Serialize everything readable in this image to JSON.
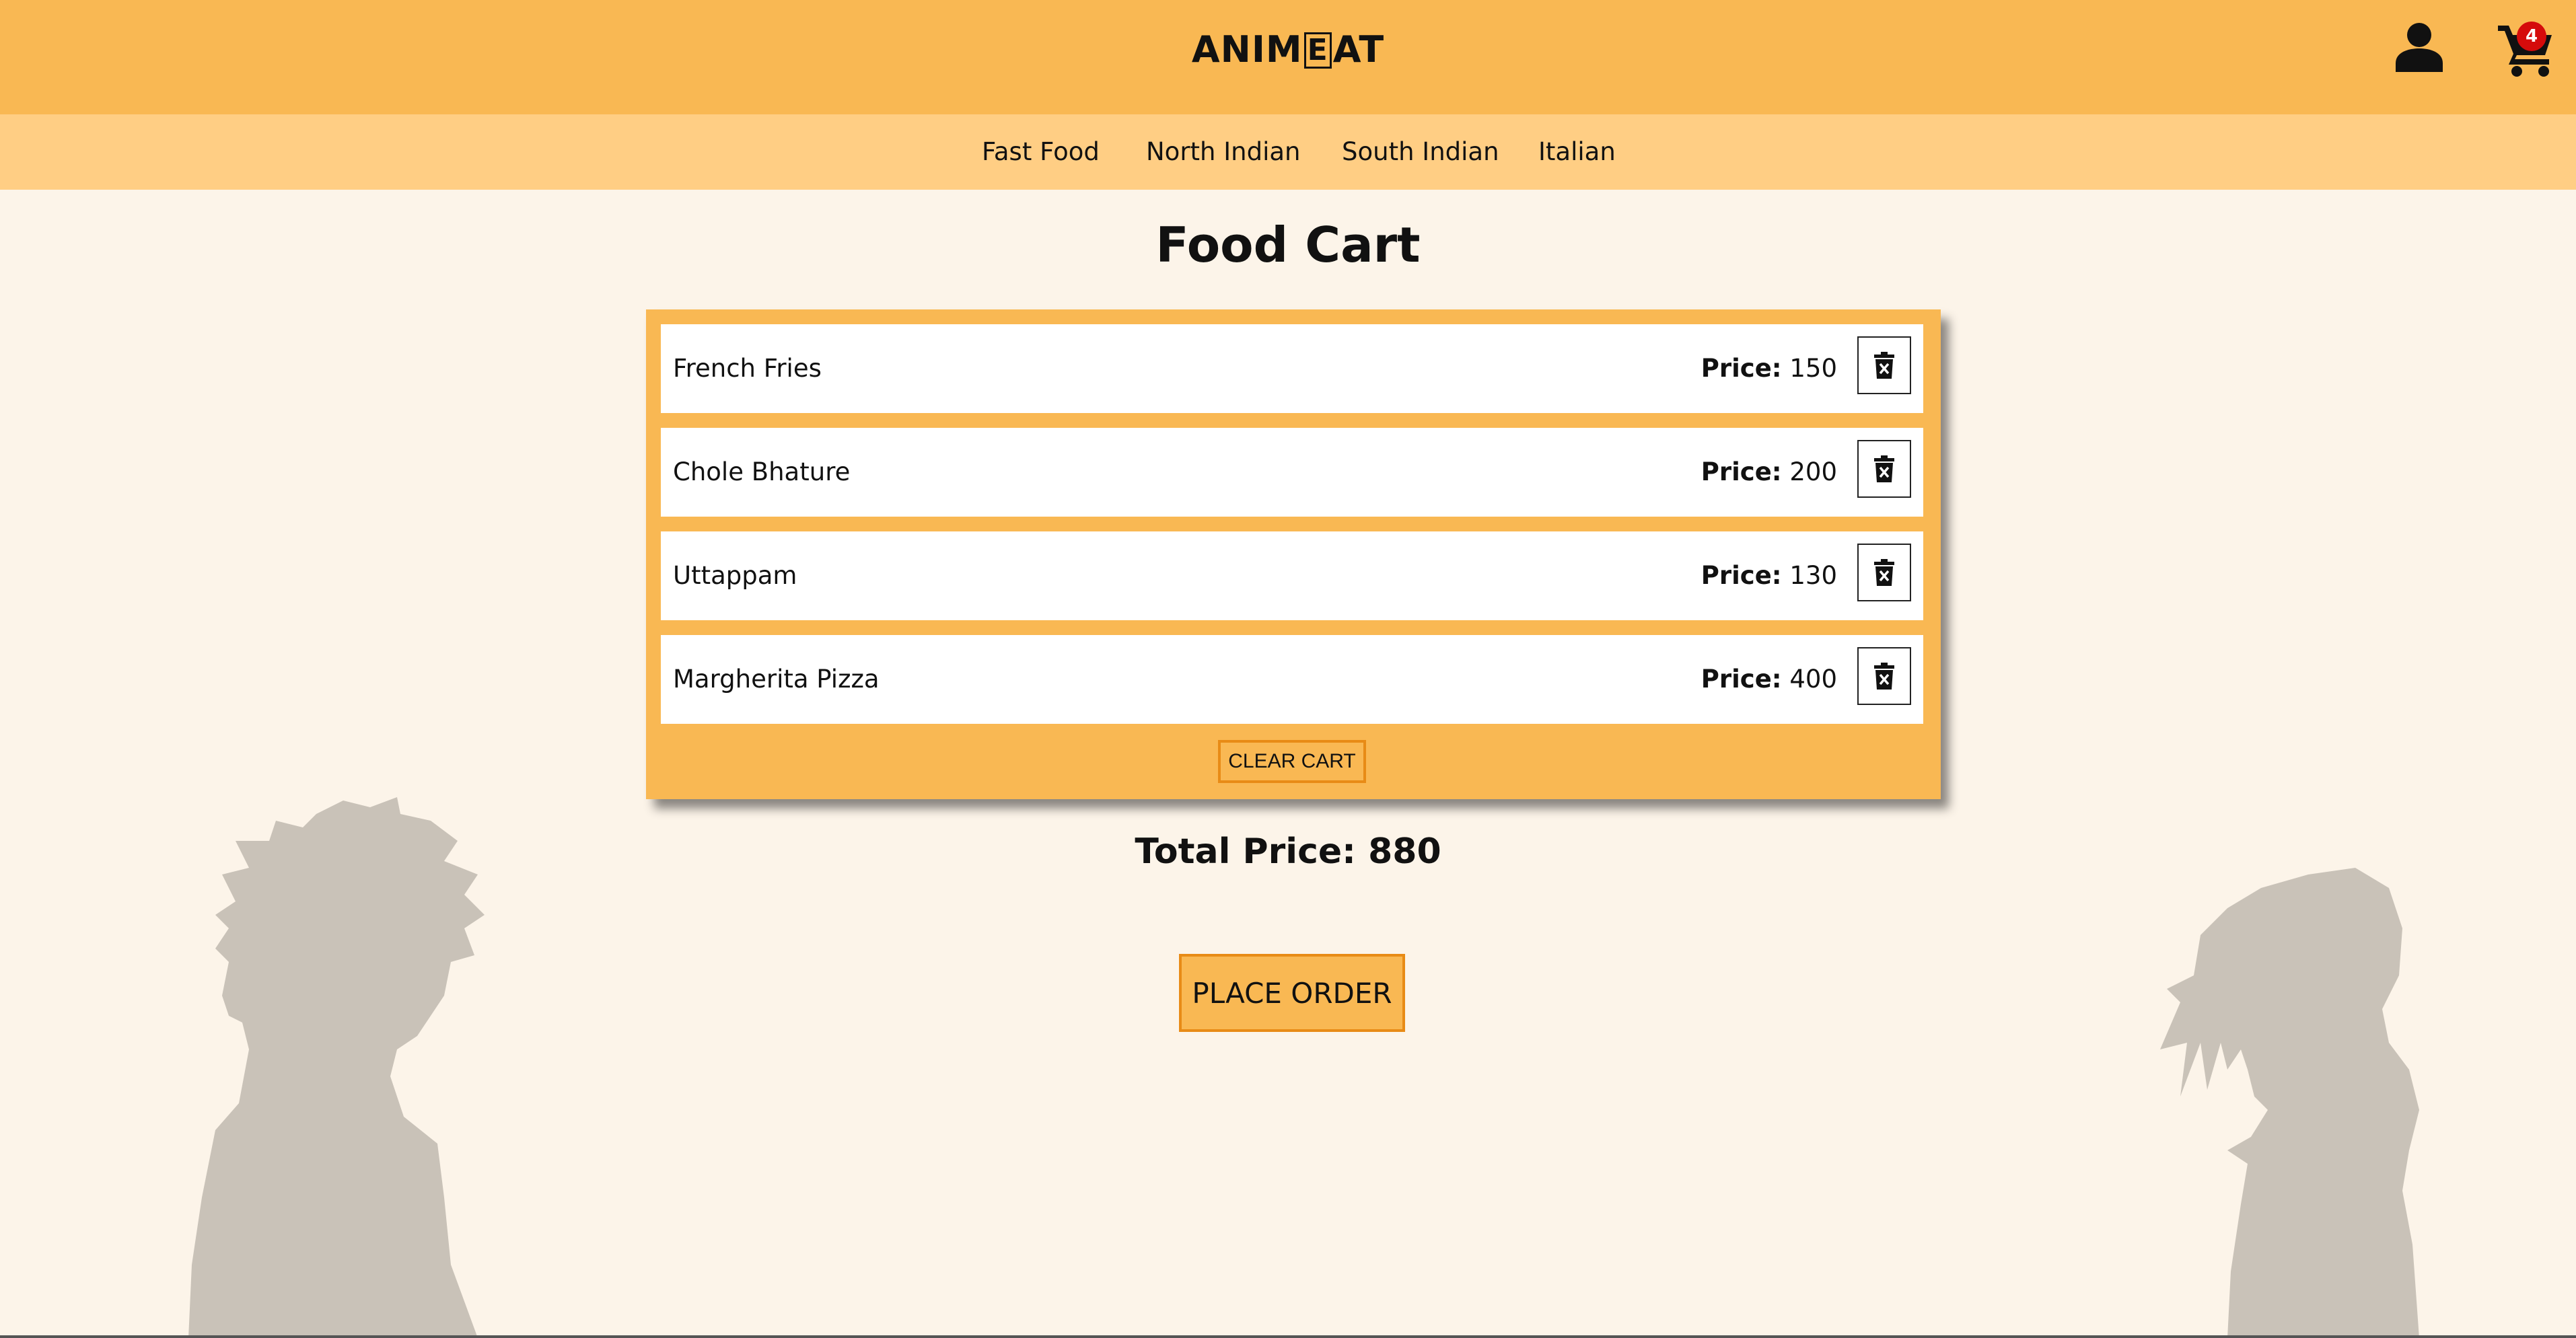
{
  "header": {
    "brand_prefix": "ANIM",
    "brand_boxed": "E",
    "brand_suffix": "AT",
    "cart_count": "4",
    "user_icon": "user-icon",
    "cart_icon": "cart-icon"
  },
  "nav": {
    "items": [
      {
        "label": "Fast Food"
      },
      {
        "label": "North Indian"
      },
      {
        "label": "South Indian"
      },
      {
        "label": "Italian"
      }
    ]
  },
  "main": {
    "title": "Food Cart",
    "price_label": "Price:",
    "cart_items": [
      {
        "name": "French Fries",
        "price": "150"
      },
      {
        "name": "Chole Bhature",
        "price": "200"
      },
      {
        "name": "Uttappam",
        "price": "130"
      },
      {
        "name": "Margherita Pizza",
        "price": "400"
      }
    ],
    "delete_icon": "trash-icon",
    "clear_cart_label": "CLEAR CART",
    "total_label": "Total Price:",
    "total_value": "880",
    "place_order_label": "PLACE ORDER"
  },
  "colors": {
    "header_bg": "#f9b853",
    "nav_bg": "#ffce84",
    "page_bg": "#fcf4e9",
    "accent_border": "#e88b16",
    "badge": "#d50b0b",
    "silhouette": "#c9c2b8"
  }
}
